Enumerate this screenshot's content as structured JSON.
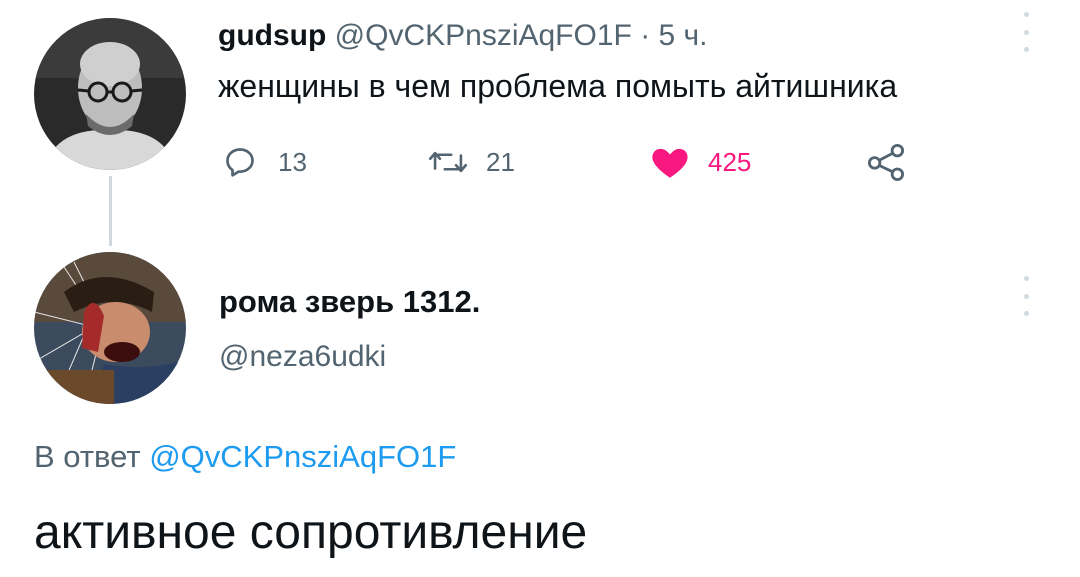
{
  "tweet1": {
    "display_name": "gudsup",
    "handle": "@QvCKPnsziAqFO1F",
    "separator": "·",
    "time": "5 ч.",
    "text": "женщины в чем проблема помыть айтишника",
    "actions": {
      "reply_count": "13",
      "retweet_count": "21",
      "like_count": "425",
      "like_state": "liked"
    },
    "icons": {
      "reply": "reply-bubble-icon",
      "retweet": "retweet-icon",
      "like": "heart-filled-icon",
      "share": "share-icon",
      "more": "more-vertical-icon"
    }
  },
  "tweet2": {
    "display_name": "рома зверь 1312.",
    "handle": "@neza6udki",
    "reply_prefix": "В ответ",
    "reply_mention": "@QvCKPnsziAqFO1F",
    "text": "активное сопротивление",
    "icons": {
      "more": "more-vertical-icon"
    }
  },
  "colors": {
    "text_primary": "#0f1419",
    "text_secondary": "#536471",
    "like_pink": "#f91880",
    "mention_blue": "#1d9bf0",
    "thread_line": "#cfd9de"
  }
}
